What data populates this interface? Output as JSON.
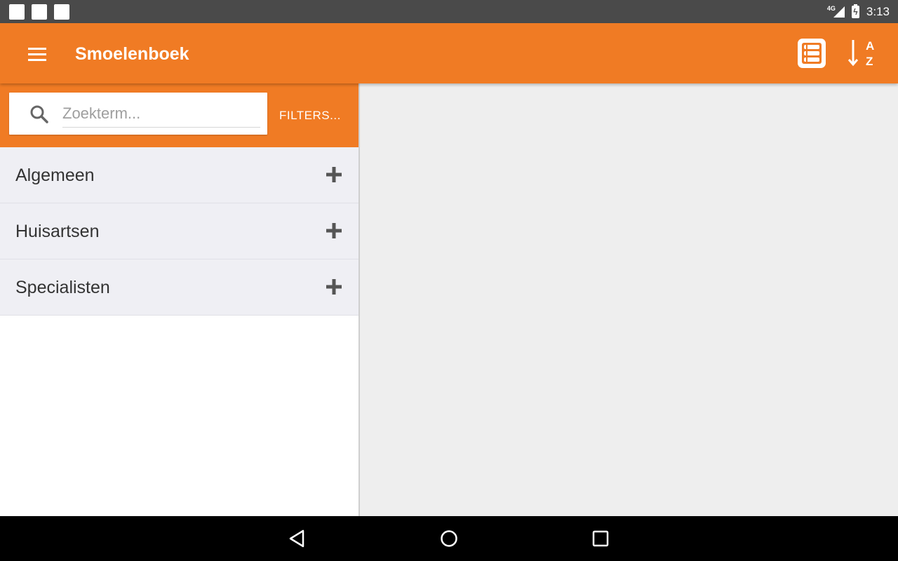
{
  "status_bar": {
    "network": "4G",
    "time": "3:13"
  },
  "app_bar": {
    "title": "Smoelenboek"
  },
  "search": {
    "placeholder": "Zoekterm...",
    "value": ""
  },
  "filters": {
    "label": "FILTERS..."
  },
  "categories": [
    {
      "label": "Algemeen"
    },
    {
      "label": "Huisartsen"
    },
    {
      "label": "Specialisten"
    }
  ],
  "colors": {
    "accent": "#f07b24",
    "status_bar": "#4a4a4a",
    "list_bg": "#efeff4",
    "detail_bg": "#eeeeee"
  },
  "icons": {
    "menu": "menu-icon",
    "view": "list-view-icon",
    "sort": "sort-az-icon",
    "search": "search-icon",
    "expand": "plus-icon"
  }
}
